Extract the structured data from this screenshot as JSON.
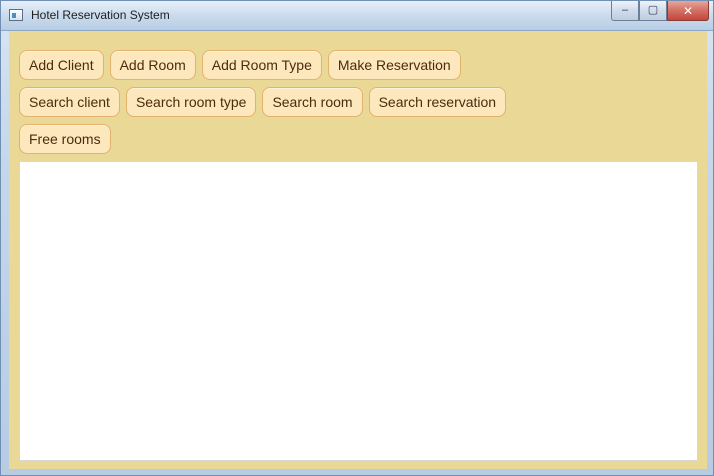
{
  "window": {
    "title": "Hotel Reservation System"
  },
  "toolbar": {
    "row1": [
      "Add Client",
      "Add Room",
      "Add Room Type",
      "Make Reservation"
    ],
    "row2": [
      "Search client",
      "Search room type",
      "Search room",
      "Search reservation"
    ],
    "row3": [
      "Free rooms"
    ]
  },
  "caption_buttons": {
    "minimize": "–",
    "maximize": "▢",
    "close": "✕"
  }
}
